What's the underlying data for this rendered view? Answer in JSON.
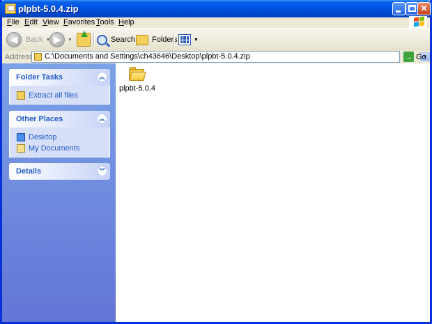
{
  "window": {
    "title": "plpbt-5.0.4.zip"
  },
  "menu": [
    {
      "key": "F",
      "rest": "ile"
    },
    {
      "key": "E",
      "rest": "dit"
    },
    {
      "key": "V",
      "rest": "iew"
    },
    {
      "key": "F",
      "rest": "avorites",
      "pre": ""
    },
    {
      "key": "T",
      "rest": "ools"
    },
    {
      "key": "H",
      "rest": "elp"
    }
  ],
  "toolbar": {
    "back_label": "Back",
    "search_label": "Search",
    "folders_label": "Folders"
  },
  "address": {
    "label": "Address",
    "value": "C:\\Documents and Settings\\ch43646\\Desktop\\plpbt-5.0.4.zip",
    "go_label": "Go"
  },
  "panels": {
    "folder_tasks": {
      "title": "Folder Tasks",
      "items": [
        "Extract all files"
      ]
    },
    "other_places": {
      "title": "Other Places",
      "items": [
        "Desktop",
        "My Documents"
      ]
    },
    "details": {
      "title": "Details"
    }
  },
  "content": {
    "items": [
      {
        "name": "plpbt-5.0.4",
        "icon": "folder-icon"
      }
    ]
  },
  "colors": {
    "titlebar": "#0055E5",
    "taskpane_link": "#215DC6",
    "taskpane_bg_top": "#7BA2E7",
    "taskpane_bg_bottom": "#6375D6"
  }
}
